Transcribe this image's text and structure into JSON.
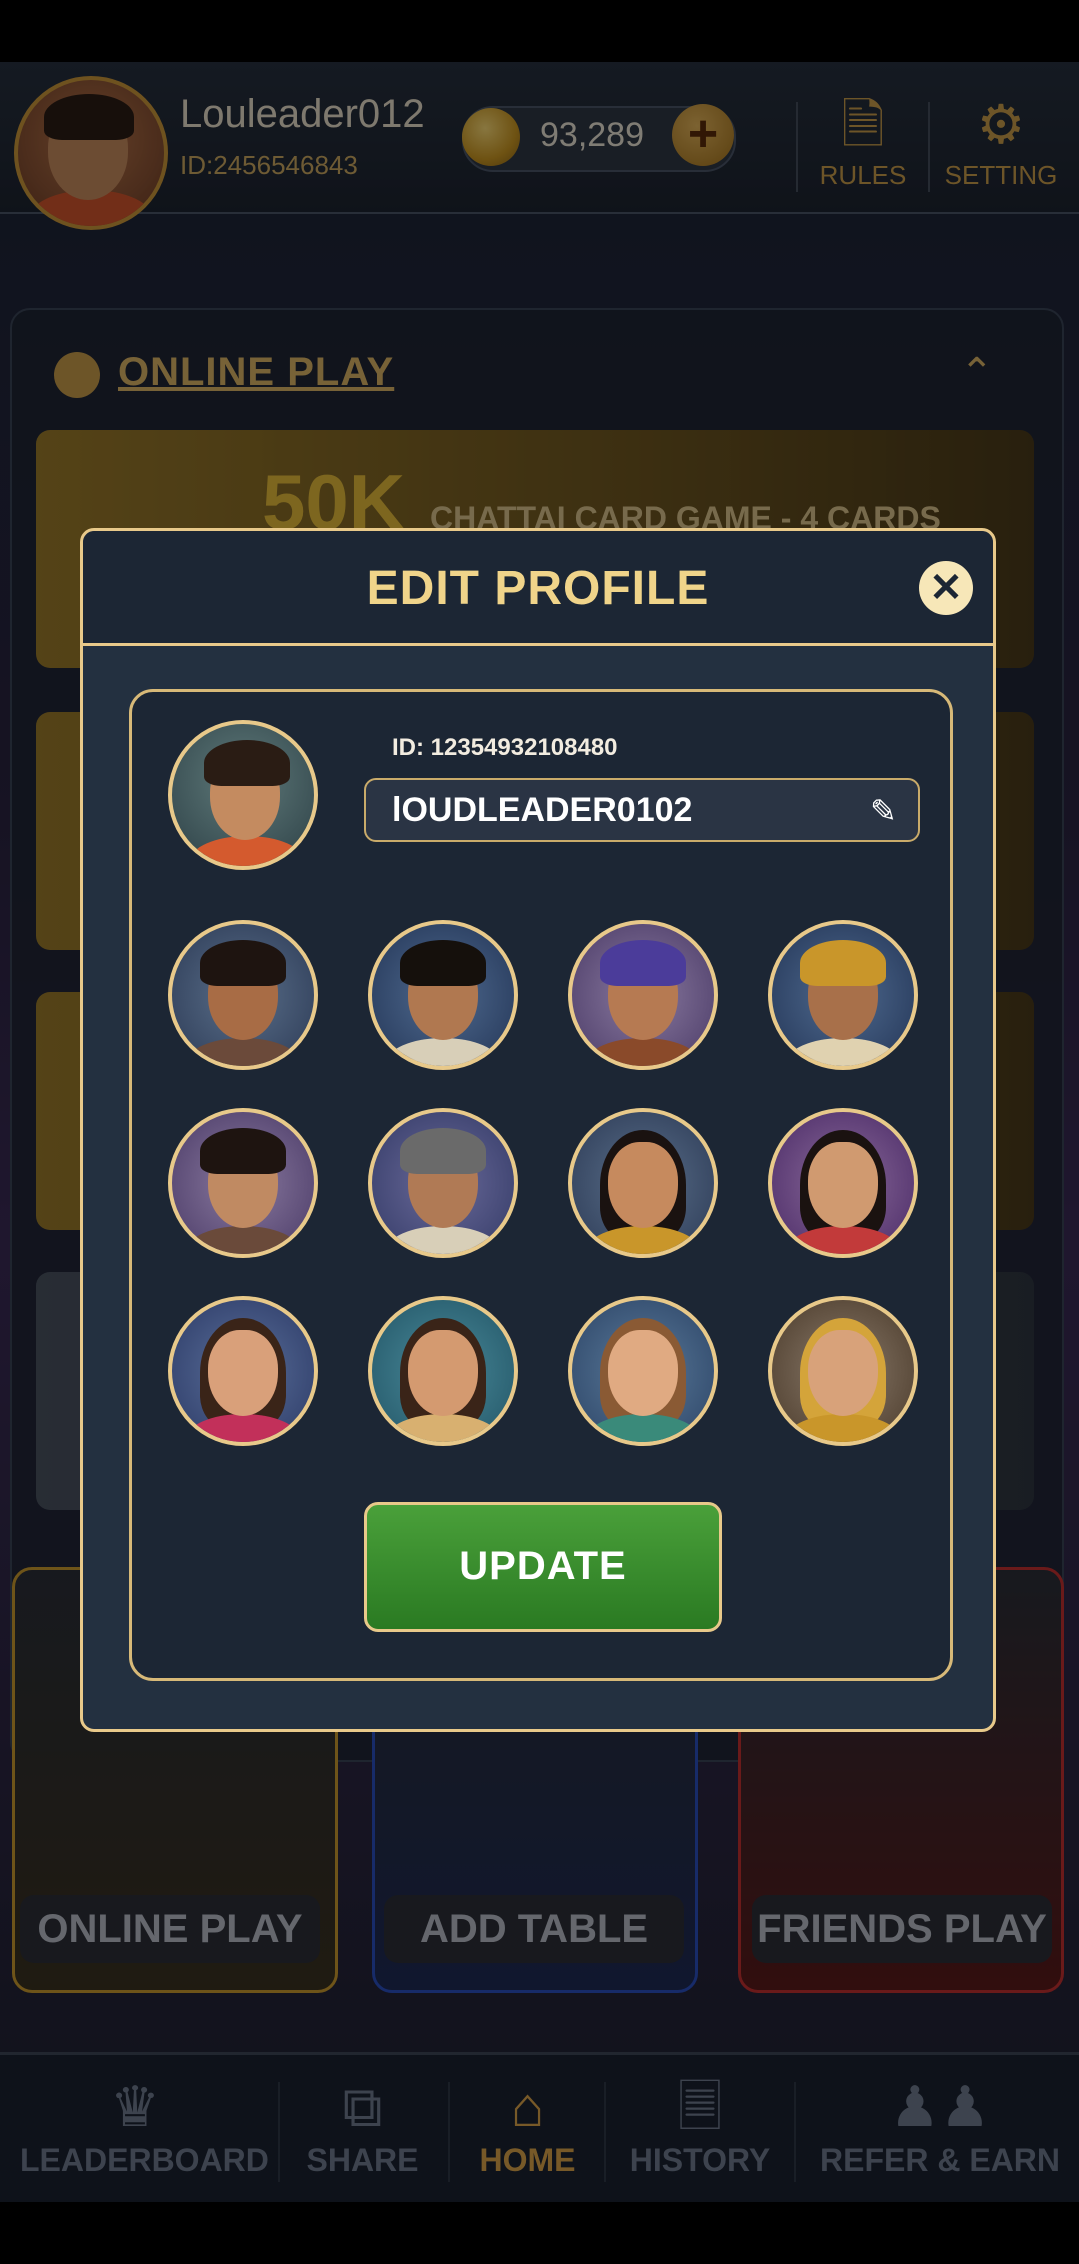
{
  "header": {
    "username": "Louleader012",
    "user_id": "ID:2456546843",
    "coins": "93,289",
    "rules_label": "RULES",
    "setting_label": "SETTING"
  },
  "background": {
    "section_title": "ONLINE PLAY",
    "banner_amount": "50K",
    "banner_text": "CHATTAI CARD GAME - 4 CARDS",
    "cards": [
      "ONLINE PLAY",
      "ADD TABLE",
      "FRIENDS PLAY"
    ]
  },
  "modal": {
    "title": "EDIT PROFILE",
    "id_text": "ID: 12354932108480",
    "name_value": "lOUDLEADER0102",
    "update_label": "UPDATE"
  },
  "nav": {
    "items": [
      "LEADERBOARD",
      "SHARE",
      "HOME",
      "HISTORY",
      "REFER & EARN"
    ],
    "active": "HOME"
  },
  "colors": {
    "accent_gold": "#e8c98a",
    "update_green": "#3a8f2e",
    "panel_dark": "#1c2634"
  }
}
